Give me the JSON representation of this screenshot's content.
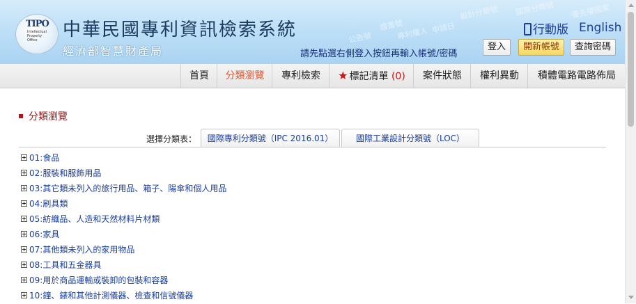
{
  "header": {
    "logo_text": "TIPO",
    "logo_sub": "Intellectual Property Office",
    "title": "中華民國專利資訊檢索系統",
    "subtitle": "經濟部智慧財產局",
    "mobile_label": "行動版",
    "english_label": "English",
    "login_hint": "請先點選右側登入按鈕再輸入帳號/密碼",
    "login_button": "登入",
    "open_account_button": "開新帳號",
    "query_password_button": "查詢密碼",
    "watermark_words": [
      "國際分類號",
      "設計分類號",
      "優先權國家",
      "專利權人",
      "申請日",
      "公告號",
      "證書號"
    ]
  },
  "nav": {
    "items": [
      {
        "label": "首頁"
      },
      {
        "label": "分類瀏覽"
      },
      {
        "label": "專利檢索"
      },
      {
        "label": "標記清單",
        "count": "(0)"
      },
      {
        "label": "案件狀態"
      },
      {
        "label": "權利異動"
      },
      {
        "label": "積體電路電路佈局"
      }
    ],
    "active": "分類瀏覽"
  },
  "main": {
    "section_title": "分類瀏覽",
    "select_label": "選擇分類表：",
    "tabs": [
      {
        "label": "國際專利分類號（IPC 2016.01）"
      },
      {
        "label": "國際工業設計分類號（LOC）"
      }
    ],
    "tree": [
      "01:食品",
      "02:服裝和服飾用品",
      "03:其它類未列入的旅行用品、箱子、陽傘和個人用品",
      "04:刷具類",
      "05:紡織品、人造和天然材料片材類",
      "06:家具",
      "07:其他類未列入的家用物品",
      "08:工具和五金器具",
      "09:用於商品運輸或裝卸的包裝和容器",
      "10:鐘、錶和其他計測儀器、檢查和信號儀器"
    ]
  },
  "colors": {
    "accent_red": "#b5121b",
    "link_blue": "#1a3e9c",
    "active_nav": "#e4572e",
    "banner": "#bfe0f7"
  }
}
